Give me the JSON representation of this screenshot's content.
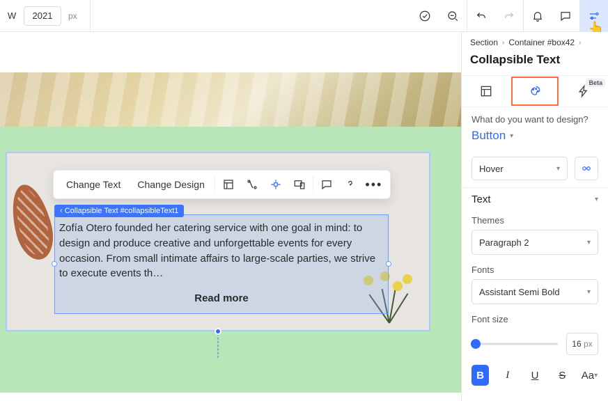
{
  "topbar": {
    "w_label": "W",
    "width_value": "2021",
    "unit": "px"
  },
  "toolbar": {
    "change_text": "Change Text",
    "change_design": "Change Design"
  },
  "selection": {
    "tag": "Collapsible Text #collapsibleText1",
    "body": "Zofía Otero founded her catering service with one goal in mind: to design and produce creative and unforgettable events for every occasion. From small intimate affairs to large-scale parties, we strive to execute events th…",
    "read_more": "Read more"
  },
  "side": {
    "breadcrumbs": [
      "Section",
      "Container #box42"
    ],
    "panel_title": "Collapsible Text",
    "beta_label": "Beta",
    "design_question": "What do you want to design?",
    "target": "Button",
    "state_select": "Hover",
    "accordion_text": "Text",
    "themes_label": "Themes",
    "themes_value": "Paragraph 2",
    "fonts_label": "Fonts",
    "fonts_value": "Assistant Semi Bold",
    "fontsize_label": "Font size",
    "fontsize_value": "16",
    "fontsize_unit": "px",
    "fmt": {
      "b": "B",
      "i": "I",
      "u": "U",
      "s": "S",
      "aa": "Aa"
    }
  }
}
